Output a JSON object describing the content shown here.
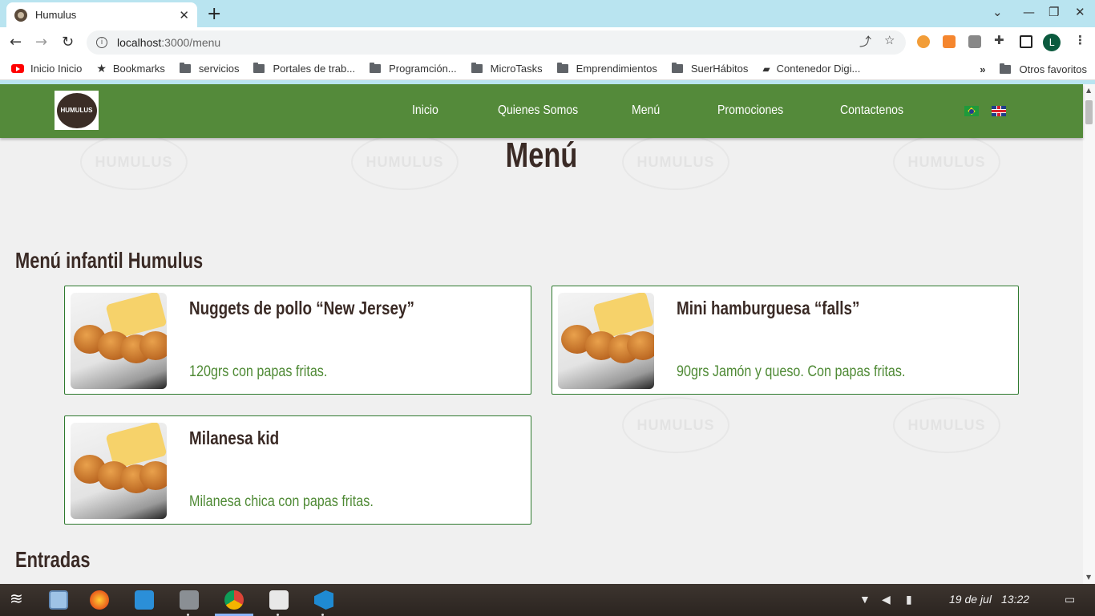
{
  "browser": {
    "tab_title": "Humulus",
    "tab_close": "✕",
    "new_tab": "+",
    "url_host": "localhost",
    "url_path": ":3000/menu",
    "profile_initial": "L",
    "window_controls": [
      "⌄",
      "—",
      "❐",
      "✕"
    ]
  },
  "bookmarks": {
    "items": [
      {
        "label": "Inicio Inicio",
        "icon": "youtube-icon"
      },
      {
        "label": "Bookmarks",
        "icon": "star-icon"
      },
      {
        "label": "servicios",
        "icon": "folder-icon"
      },
      {
        "label": "Portales de trab...",
        "icon": "folder-icon"
      },
      {
        "label": "Programción...",
        "icon": "folder-icon"
      },
      {
        "label": "MicroTasks",
        "icon": "folder-icon"
      },
      {
        "label": "Emprendimientos",
        "icon": "folder-icon"
      },
      {
        "label": "SuerHábitos",
        "icon": "folder-icon"
      },
      {
        "label": "Contenedor Digi...",
        "icon": "drive-icon"
      }
    ],
    "overflow": "»",
    "other": "Otros favoritos"
  },
  "site": {
    "logo_text": "HUMULUS",
    "watermark_text": "HUMULUS",
    "nav": [
      "Inicio",
      "Quienes Somos",
      "Menú",
      "Promociones",
      "Contactenos"
    ],
    "page_title": "Menú",
    "sections": [
      {
        "title": "Menú infantil Humulus",
        "items": [
          {
            "name": "Nuggets de pollo “New Jersey”",
            "desc": "120grs con papas fritas."
          },
          {
            "name": "Mini hamburguesa “falls”",
            "desc": "90grs Jamón y queso. Con papas fritas."
          },
          {
            "name": "Milanesa kid",
            "desc": "Milanesa chica con papas fritas."
          }
        ]
      },
      {
        "title": "Entradas",
        "items": []
      }
    ],
    "colors": {
      "nav_bg": "#548a3a",
      "title": "#3a2a25",
      "desc": "#4f8a35",
      "card_border": "#2f7a2f"
    }
  },
  "taskbar": {
    "date": "19 de jul",
    "time": "13:22"
  }
}
